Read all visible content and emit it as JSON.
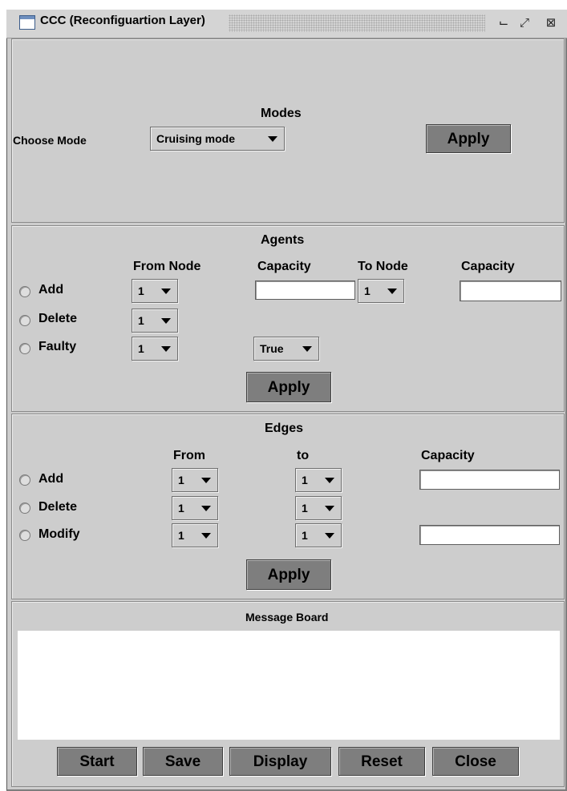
{
  "window": {
    "title": "CCC (Reconfiguartion Layer)",
    "controls": [
      "⌙",
      "⤢",
      "⊠"
    ]
  },
  "modes": {
    "heading": "Modes",
    "choose_label": "Choose Mode",
    "selected_mode": "Cruising mode",
    "apply_label": "Apply"
  },
  "agents": {
    "heading": "Agents",
    "col_from_node": "From Node",
    "col_capacity": "Capacity",
    "col_to_node": "To Node",
    "col_capacity2": "Capacity",
    "rows": [
      {
        "label": "Add",
        "from": "1",
        "capacity": "",
        "to": "1",
        "capacity2": ""
      },
      {
        "label": "Delete",
        "from": "1"
      },
      {
        "label": "Faulty",
        "from": "1",
        "status": "True"
      }
    ],
    "apply_label": "Apply"
  },
  "edges": {
    "heading": "Edges",
    "col_from": "From",
    "col_to": "to",
    "col_capacity": "Capacity",
    "rows": [
      {
        "label": "Add",
        "from": "1",
        "to": "1",
        "capacity": ""
      },
      {
        "label": "Delete",
        "from": "1",
        "to": "1"
      },
      {
        "label": "Modify",
        "from": "1",
        "to": "1",
        "capacity": ""
      }
    ],
    "apply_label": "Apply"
  },
  "message_board": {
    "heading": "Message Board",
    "content": ""
  },
  "footer": {
    "start": "Start",
    "save": "Save",
    "display": "Display",
    "reset": "Reset",
    "close": "Close"
  }
}
